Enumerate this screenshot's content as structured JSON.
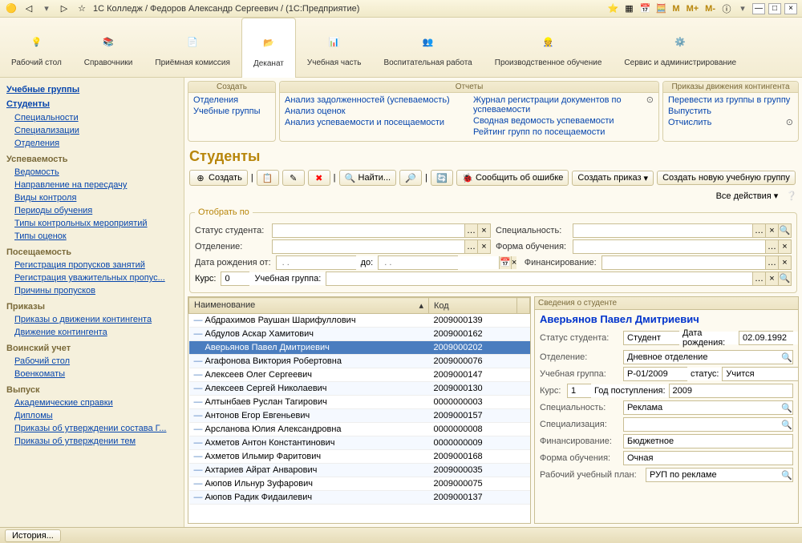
{
  "titlebar": {
    "title": "1С Колледж / Федоров Александр Сергеевич / (1С:Предприятие)",
    "m": "M",
    "mp": "M+",
    "mm": "M-"
  },
  "ribbon": [
    {
      "label": "Рабочий\nстол"
    },
    {
      "label": "Справочники"
    },
    {
      "label": "Приёмная\nкомиссия"
    },
    {
      "label": "Деканат"
    },
    {
      "label": "Учебная\nчасть"
    },
    {
      "label": "Воспитательная\nработа"
    },
    {
      "label": "Производственное\nобучение"
    },
    {
      "label": "Сервис и\nадминистрирование"
    }
  ],
  "nav": {
    "top": [
      {
        "label": "Учебные группы"
      },
      {
        "label": "Студенты"
      }
    ],
    "sections": [
      {
        "links": [
          "Специальности",
          "Специализации",
          "Отделения"
        ]
      },
      {
        "title": "Успеваемость",
        "links": [
          "Ведомость",
          "Направление на пересдачу",
          "Виды контроля",
          "Периоды обучения",
          "Типы контрольных мероприятий",
          "Типы оценок"
        ]
      },
      {
        "title": "Посещаемость",
        "links": [
          "Регистрация пропусков занятий",
          "Регистрация уважительных пропус...",
          "Причины пропусков"
        ]
      },
      {
        "title": "Приказы",
        "links": [
          "Приказы о движении контингента",
          "Движение контингента"
        ]
      },
      {
        "title": "Воинский учет",
        "links": [
          "Рабочий стол",
          "Военкоматы"
        ]
      },
      {
        "title": "Выпуск",
        "links": [
          "Академические справки",
          "Дипломы",
          "Приказы об утверждении состава Г...",
          "Приказы об утверждении тем"
        ]
      }
    ]
  },
  "panels": {
    "create": {
      "title": "Создать",
      "links": [
        "Отделения",
        "Учебные группы"
      ]
    },
    "reports": {
      "title": "Отчеты",
      "left": [
        "Анализ задолженностей (успеваемость)",
        "Анализ оценок",
        "Анализ успеваемости и посещаемости"
      ],
      "right": [
        "Журнал регистрации документов по успеваемости",
        "Сводная ведомость успеваемости",
        "Рейтинг групп по посещаемости"
      ]
    },
    "orders": {
      "title": "Приказы движения контингента",
      "links": [
        "Перевести из группы в группу",
        "Выпустить",
        "Отчислить"
      ]
    }
  },
  "content": {
    "title": "Студенты",
    "toolbar": {
      "create": "Создать",
      "find": "Найти...",
      "report_err": "Сообщить об ошибке",
      "create_order": "Создать приказ",
      "create_group": "Создать новую учебную группу",
      "all_actions": "Все действия"
    },
    "filter": {
      "legend": "Отобрать по",
      "status": "Статус студента:",
      "spec": "Специальность:",
      "dept": "Отделение:",
      "form": "Форма обучения:",
      "birth_from": "Дата рождения от:",
      "birth_to": "до:",
      "fund": "Финансирование:",
      "course": "Курс:",
      "course_val": "0",
      "group": "Учебная группа:"
    },
    "columns": {
      "name": "Наименование",
      "code": "Код"
    },
    "rows": [
      {
        "name": "Абдрахимов Раушан Шарифуллович",
        "code": "2009000139"
      },
      {
        "name": "Абдулов Аскар Хамитович",
        "code": "2009000162"
      },
      {
        "name": "Аверьянов Павел Дмитриевич",
        "code": "2009000202"
      },
      {
        "name": "Агафонова Виктория Робертовна",
        "code": "2009000076"
      },
      {
        "name": "Алексеев Олег Сергеевич",
        "code": "2009000147"
      },
      {
        "name": "Алексеев Сергей Николаевич",
        "code": "2009000130"
      },
      {
        "name": "Алтынбаев Руслан Тагирович",
        "code": "0000000003"
      },
      {
        "name": "Антонов Егор Евгеньевич",
        "code": "2009000157"
      },
      {
        "name": "Арсланова Юлия Александровна",
        "code": "0000000008"
      },
      {
        "name": "Ахметов Антон Константинович",
        "code": "0000000009"
      },
      {
        "name": "Ахметов Ильмир Фаритович",
        "code": "2009000168"
      },
      {
        "name": "Ахтариев Айрат Анварович",
        "code": "2009000035"
      },
      {
        "name": "Аюпов Ильнур Зуфарович",
        "code": "2009000075"
      },
      {
        "name": "Аюпов Радик Фидаилевич",
        "code": "2009000137"
      }
    ]
  },
  "details": {
    "title": "Сведения о студенте",
    "name": "Аверьянов Павел Дмитриевич",
    "labels": {
      "status": "Статус студента:",
      "birth": "Дата рождения:",
      "dept": "Отделение:",
      "group": "Учебная группа:",
      "gstatus": "статус:",
      "course": "Курс:",
      "year": "Год поступления:",
      "spec": "Специальность:",
      "specz": "Специализация:",
      "fund": "Финансирование:",
      "form": "Форма обучения:",
      "plan": "Рабочий учебный план:"
    },
    "values": {
      "status": "Студент",
      "birth": "02.09.1992",
      "dept": "Дневное отделение",
      "group": "Р-01/2009",
      "gstatus": "Учится",
      "course": "1",
      "year": "2009",
      "spec": "Реклама",
      "specz": "",
      "fund": "Бюджетное",
      "form": "Очная",
      "plan": "РУП по рекламе"
    }
  },
  "statusbar": {
    "history": "История..."
  }
}
